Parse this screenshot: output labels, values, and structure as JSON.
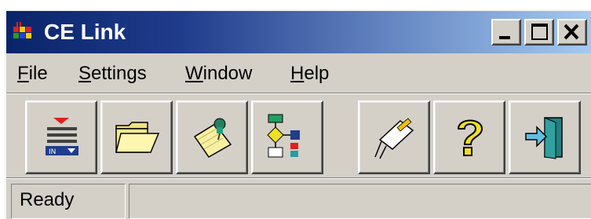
{
  "window": {
    "title": "CE Link"
  },
  "title_buttons": [
    {
      "name": "minimize",
      "icon": "minimize-icon"
    },
    {
      "name": "maximize",
      "icon": "maximize-icon"
    },
    {
      "name": "close",
      "icon": "close-icon"
    }
  ],
  "menu": {
    "file": {
      "accel": "F",
      "rest": "ile"
    },
    "settings": {
      "accel": "S",
      "rest": "ettings"
    },
    "window": {
      "accel": "W",
      "rest": "indow"
    },
    "help": {
      "accel": "H",
      "rest": "elp"
    }
  },
  "toolbar": [
    {
      "icon": "inbox-icon"
    },
    {
      "icon": "folder-open-icon"
    },
    {
      "icon": "note-pin-icon"
    },
    {
      "icon": "flowchart-icon"
    },
    {
      "icon": "connector-cable-icon"
    },
    {
      "icon": "help-question-icon"
    },
    {
      "icon": "exit-door-icon"
    }
  ],
  "status": {
    "text": "Ready",
    "pane2": ""
  },
  "colors": {
    "face": "#d4d0c8",
    "title_start": "#0a246a",
    "title_end": "#a6caf0"
  }
}
